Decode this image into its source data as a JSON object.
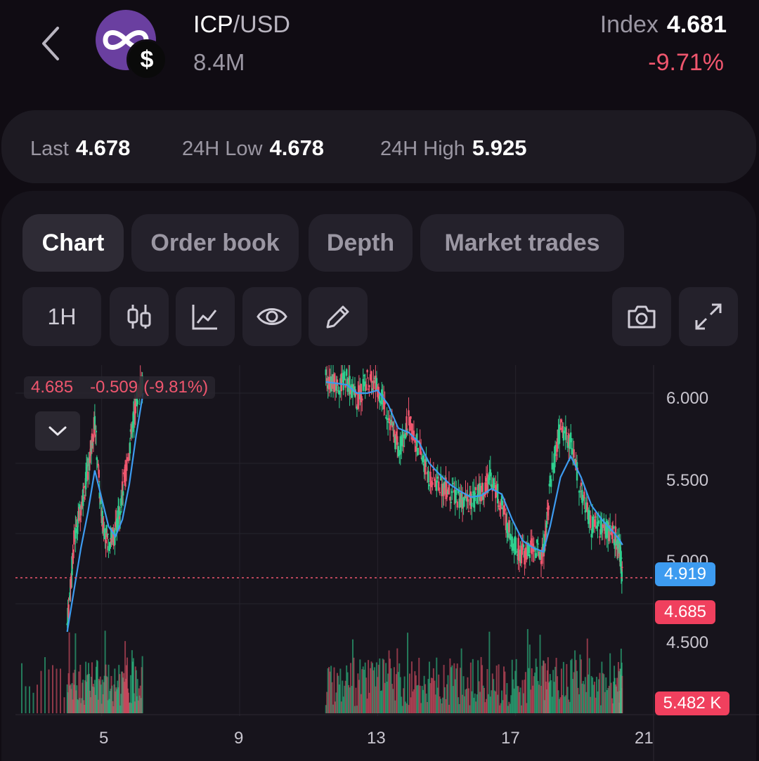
{
  "header": {
    "back_icon": "chevron-left-icon",
    "logo_icon": "icp-infinity-logo-icon",
    "badge_symbol": "$",
    "base": "ICP",
    "quote": "/USD",
    "volume": "8.4M",
    "index_label": "Index",
    "index_value": "4.681",
    "change": "-9.71%"
  },
  "stats": {
    "last_label": "Last",
    "last_value": "4.678",
    "low_label": "24H Low",
    "low_value": "4.678",
    "high_label": "24H High",
    "high_value": "5.925"
  },
  "tabs": [
    {
      "label": "Chart",
      "active": true
    },
    {
      "label": "Order book",
      "active": false
    },
    {
      "label": "Depth",
      "active": false
    },
    {
      "label": "Market trades",
      "active": false
    }
  ],
  "toolbar": {
    "interval": "1H",
    "icons": [
      "candlestick-icon",
      "line-chart-icon",
      "eye-icon",
      "pencil-icon",
      "camera-icon",
      "expand-icon"
    ]
  },
  "ohlc": {
    "price": "4.685",
    "change": "-0.509",
    "change_pct": "(-9.81%)"
  },
  "colors": {
    "up": "#2fd08f",
    "down": "#f0566e",
    "ma": "#3d9bf0",
    "background": "#100c13"
  },
  "chart_data": {
    "type": "line",
    "y_ticks": [
      "6.000",
      "5.500",
      "5.000",
      "4.500"
    ],
    "x_ticks": [
      "5",
      "9",
      "13",
      "17",
      "21"
    ],
    "ylim": [
      4.25,
      6.15
    ],
    "xlim": [
      2.5,
      21
    ],
    "grid": true,
    "price_labels": {
      "ma_value": "4.919",
      "last_price": "4.685",
      "volume_value": "5.482 K"
    },
    "series": [
      {
        "kind": "price",
        "x": [
          4.0,
          4.2,
          4.4,
          4.6,
          4.8,
          5.0,
          5.2,
          5.4,
          5.6,
          5.8,
          6.0,
          6.2,
          11.5,
          11.8,
          12.1,
          12.4,
          12.7,
          13.0,
          13.3,
          13.6,
          13.9,
          14.2,
          14.5,
          14.8,
          15.1,
          15.4,
          15.7,
          16.0,
          16.3,
          16.6,
          16.9,
          17.2,
          17.5,
          17.8,
          18.0,
          18.3,
          18.6,
          18.9,
          19.2,
          19.5,
          19.8,
          20.0,
          20.1
        ],
        "y": [
          4.35,
          4.95,
          5.2,
          5.45,
          5.8,
          5.1,
          4.95,
          5.0,
          5.3,
          5.6,
          5.95,
          6.1,
          6.1,
          6.05,
          6.1,
          5.95,
          6.1,
          6.05,
          5.85,
          5.6,
          5.8,
          5.6,
          5.4,
          5.35,
          5.3,
          5.25,
          5.22,
          5.3,
          5.4,
          5.2,
          4.95,
          4.85,
          4.9,
          4.85,
          5.35,
          5.75,
          5.65,
          5.3,
          5.05,
          5.05,
          5.0,
          4.95,
          4.685
        ]
      },
      {
        "kind": "ma",
        "x": [
          4.0,
          4.2,
          4.4,
          4.6,
          4.8,
          5.0,
          5.2,
          5.4,
          5.6,
          5.8,
          6.0,
          6.2,
          11.5,
          11.8,
          12.1,
          12.4,
          12.7,
          13.0,
          13.3,
          13.6,
          13.9,
          14.2,
          14.5,
          14.8,
          15.1,
          15.4,
          15.7,
          16.0,
          16.3,
          16.6,
          16.9,
          17.2,
          17.5,
          17.8,
          18.0,
          18.3,
          18.6,
          18.9,
          19.2,
          19.5,
          19.8,
          20.0,
          20.1
        ],
        "y": [
          4.3,
          4.6,
          4.9,
          5.15,
          5.45,
          5.25,
          5.05,
          4.98,
          5.1,
          5.35,
          5.7,
          6.0,
          6.08,
          6.07,
          6.06,
          6.0,
          6.0,
          6.02,
          5.92,
          5.75,
          5.72,
          5.65,
          5.5,
          5.42,
          5.35,
          5.3,
          5.26,
          5.27,
          5.32,
          5.28,
          5.1,
          4.95,
          4.9,
          4.87,
          5.05,
          5.4,
          5.55,
          5.4,
          5.2,
          5.1,
          5.02,
          4.96,
          4.919
        ]
      }
    ]
  }
}
